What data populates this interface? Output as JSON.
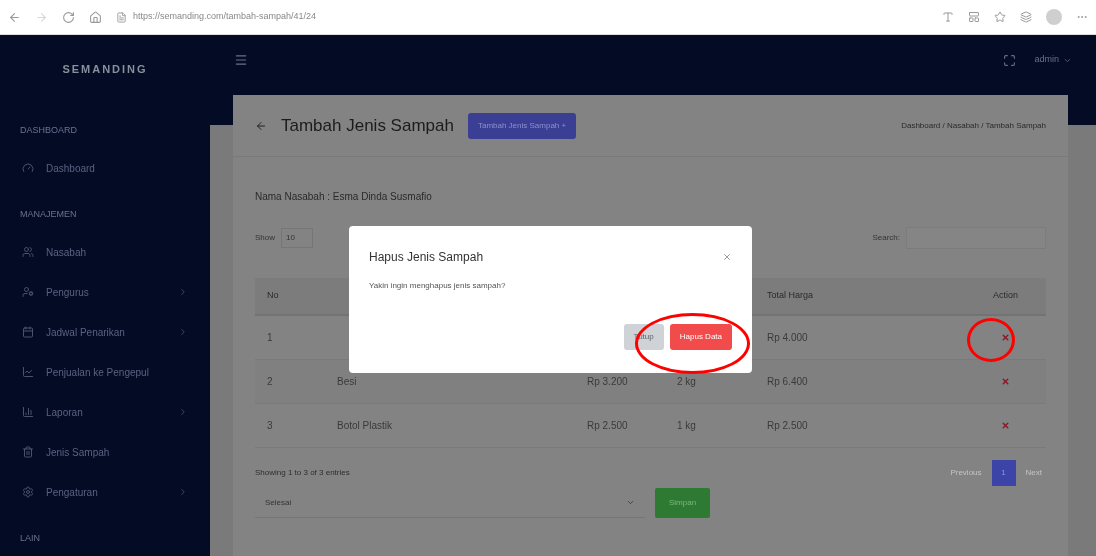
{
  "browser": {
    "url": "https://semanding.com/tambah-sampah/41/24"
  },
  "brand": "SEMANDING",
  "sidebar": {
    "items": [
      {
        "kind": "heading",
        "label": "DASHBOARD"
      },
      {
        "kind": "item",
        "label": "Dashboard",
        "has_submenu": false
      },
      {
        "kind": "heading",
        "label": "MANAJEMEN"
      },
      {
        "kind": "item",
        "label": "Nasabah",
        "has_submenu": false
      },
      {
        "kind": "item",
        "label": "Pengurus",
        "has_submenu": true
      },
      {
        "kind": "item",
        "label": "Jadwal Penarikan",
        "has_submenu": true
      },
      {
        "kind": "item",
        "label": "Penjualan ke Pengepul",
        "has_submenu": false
      },
      {
        "kind": "item",
        "label": "Laporan",
        "has_submenu": true
      },
      {
        "kind": "item",
        "label": "Jenis Sampah",
        "has_submenu": false
      },
      {
        "kind": "item",
        "label": "Pengaturan",
        "has_submenu": true
      },
      {
        "kind": "heading",
        "label": "LAIN"
      }
    ]
  },
  "header": {
    "user": "admin"
  },
  "page": {
    "title": "Tambah Jenis Sampah",
    "add_button": "Tambah Jenis Sampah +",
    "breadcrumb": "Dashboard / Nasabah / Tambah Sampah"
  },
  "customer_line": "Nama Nasabah : Esma Dinda Susmafio",
  "table": {
    "show_label": "Show",
    "page_size": "10",
    "search_label": "Search:",
    "columns": [
      {
        "label": "No"
      },
      {},
      {},
      {},
      {
        "label": "Total Harga"
      },
      {
        "label": "Action"
      }
    ],
    "rows": [
      {
        "cells": [
          "1",
          null,
          null,
          null,
          "Rp 4.000"
        ]
      },
      {
        "cells": [
          "2",
          "Besi",
          "Rp 3.200",
          "2 kg",
          "Rp 6.400"
        ]
      },
      {
        "cells": [
          "3",
          "Botol Plastik",
          "Rp 2.500",
          "1 kg",
          "Rp 2.500"
        ]
      }
    ],
    "info": "Showing 1 to 3 of 3 entries",
    "pagination": [
      {
        "label": "Previous",
        "selected": false
      },
      {
        "label": "1",
        "selected": true
      },
      {
        "label": "Next",
        "selected": false
      }
    ]
  },
  "status_select": {
    "value": "Selesai"
  },
  "save_button": "Simpan",
  "dialog": {
    "title": "Hapus Jenis Sampah",
    "message": "Yakin ingin menghapus jenis sampah?",
    "buttons": [
      {
        "kind": "secondary",
        "label": "Tutup"
      },
      {
        "kind": "danger",
        "label": "Hapus Data"
      }
    ]
  }
}
